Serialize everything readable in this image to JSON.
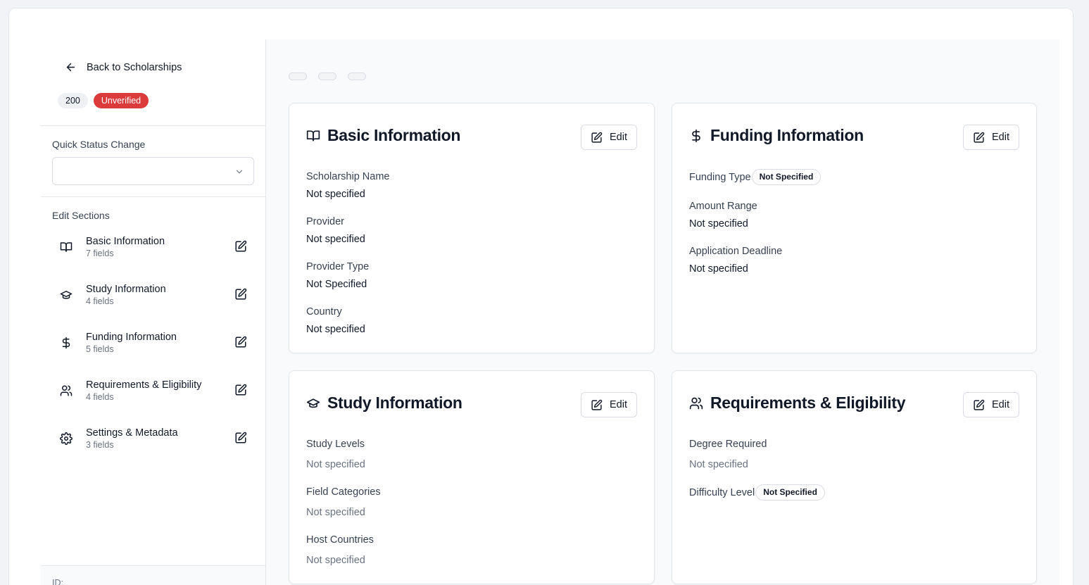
{
  "sidebar": {
    "back_label": "Back to Scholarships",
    "count_badge": "200",
    "status_badge": "Unverified",
    "quick_status_label": "Quick Status Change",
    "quick_status_value": "",
    "edit_sections_label": "Edit Sections",
    "sections": [
      {
        "title": "Basic Information",
        "sub": "7 fields",
        "icon": "book-icon"
      },
      {
        "title": "Study Information",
        "sub": "4 fields",
        "icon": "graduation-cap-icon"
      },
      {
        "title": "Funding Information",
        "sub": "5 fields",
        "icon": "dollar-icon"
      },
      {
        "title": "Requirements & Eligibility",
        "sub": "4 fields",
        "icon": "users-icon"
      },
      {
        "title": "Settings & Metadata",
        "sub": "3 fields",
        "icon": "gear-icon"
      }
    ],
    "id_label": "ID:"
  },
  "main": {
    "edit_label": "Edit",
    "cards": {
      "basic": {
        "title": "Basic Information",
        "fields": [
          {
            "label": "Scholarship Name",
            "value": "Not specified"
          },
          {
            "label": "Provider",
            "value": "Not specified"
          },
          {
            "label": "Provider Type",
            "value": "Not Specified"
          },
          {
            "label": "Country",
            "value": "Not specified"
          }
        ]
      },
      "funding": {
        "title": "Funding Information",
        "funding_type_label": "Funding Type",
        "funding_type_value": "Not Specified",
        "fields": [
          {
            "label": "Amount Range",
            "value": "Not specified"
          },
          {
            "label": "Application Deadline",
            "value": "Not specified"
          }
        ]
      },
      "study": {
        "title": "Study Information",
        "fields": [
          {
            "label": "Study Levels",
            "value": "Not specified"
          },
          {
            "label": "Field Categories",
            "value": "Not specified"
          },
          {
            "label": "Host Countries",
            "value": "Not specified"
          }
        ]
      },
      "requirements": {
        "title": "Requirements & Eligibility",
        "fields": [
          {
            "label": "Degree Required",
            "value": "Not specified"
          }
        ],
        "difficulty_label": "Difficulty Level",
        "difficulty_value": "Not Specified"
      }
    }
  },
  "colors": {
    "status_badge_bg": "#dc3b3b",
    "page_bg": "#f1f3f7",
    "main_bg": "#f9fafb"
  }
}
